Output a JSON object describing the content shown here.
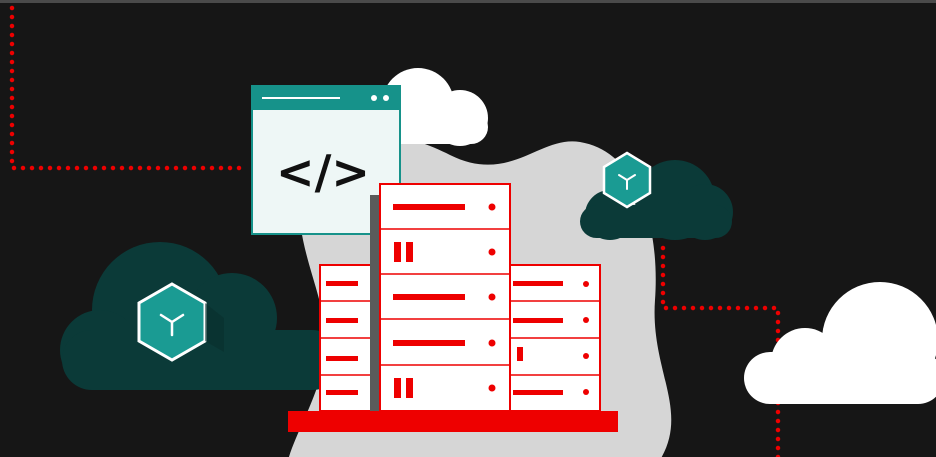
{
  "colors": {
    "background": "#161616",
    "top_bar": "#4a4a4a",
    "red": "#ee0000",
    "teal_dark": "#0b3a38",
    "teal": "#1a9b93",
    "teal_window": "#16928a",
    "white": "#ffffff",
    "blob_gray": "#d6d6d6",
    "server_face": "#ffffff",
    "server_shadow": "#5b5b5b",
    "code_glyph": "#111111",
    "window_body": "#eef7f6"
  },
  "icons": {
    "code_window": "code-brackets-icon",
    "cube_left": "cube-icon",
    "cube_right": "cube-icon"
  },
  "code_window": {
    "glyph": "</>"
  }
}
